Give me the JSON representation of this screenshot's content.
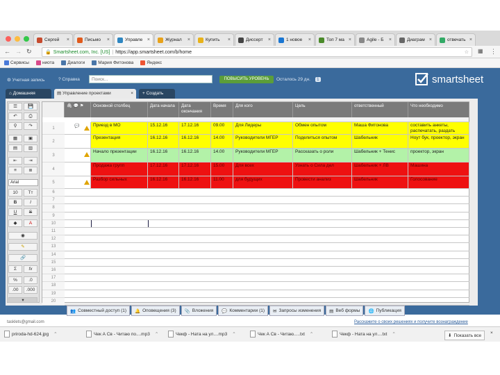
{
  "browser": {
    "tabs": [
      {
        "label": "Сергей",
        "color": "#c64a2e"
      },
      {
        "label": "Письмо",
        "color": "#e05a1c"
      },
      {
        "label": "Управле",
        "color": "#2e86c1"
      },
      {
        "label": "Журнал",
        "color": "#e8a21a"
      },
      {
        "label": "Купить",
        "color": "#e8b21a"
      },
      {
        "label": "Диссерт",
        "color": "#444"
      },
      {
        "label": "1 новое",
        "color": "#1a76d2"
      },
      {
        "label": "Топ 7 ма",
        "color": "#4a8a2a"
      },
      {
        "label": "Agile - Б",
        "color": "#888"
      },
      {
        "label": "Диаграм",
        "color": "#666"
      },
      {
        "label": "отвечать",
        "color": "#3a6"
      }
    ],
    "close": "×",
    "secure_label": "Smartsheet.com, Inc. [US]",
    "url": "https://app.smartsheet.com/b/home",
    "bookmarks": [
      "Сервисы",
      "ниота",
      "Диалоги",
      "Мария Фитонова",
      "Яндекс"
    ]
  },
  "app": {
    "account": "Учетная запись",
    "help": "Справка",
    "search_placeholder": "Поиск...",
    "upgrade": "ПОВЫСИТЬ УРОВЕНЬ",
    "trial": "Осталось 29 дн.",
    "trial_badge": "1",
    "logo": "smartsheet",
    "tabs": {
      "home": "Домашняя",
      "project": "Управление проектами",
      "new": "Создать"
    },
    "font": "Arial"
  },
  "grid": {
    "columns": [
      "Основной столбец",
      "Дата начала",
      "Дата окончания",
      "Время",
      "Для кого",
      "Цель",
      "ответственный",
      "Что необходимо"
    ],
    "rows": [
      {
        "num": "1",
        "color": "#ffff00",
        "cells": [
          "Приезд в МО",
          "15.12.16",
          "17.12.16",
          "09.00",
          "Для Лидеры",
          "Обмен опытом",
          "Маша Фитонова",
          "составить анкеты, распечатать, раздать"
        ],
        "warn": true,
        "comment": true
      },
      {
        "num": "2",
        "color": "#ffff00",
        "cells": [
          "Презентация",
          "16.12.16",
          "16.12.16",
          "14.00",
          "Руководители МГЕР",
          "Поделиться опытом",
          "Шабельник",
          "Ноут бук, проектор, экран"
        ],
        "warn": false,
        "comment": false
      },
      {
        "num": "3",
        "color": "#b3f2a8",
        "cells": [
          "Начало презентации",
          "16.12.16",
          "16.12.16",
          "14.00",
          "Руководители МГЕР",
          "Рассказать о роли",
          "Шабельник + Тенис",
          "проектор, экран"
        ],
        "warn": true,
        "comment": false
      },
      {
        "num": "4",
        "color": "#ee1111",
        "cells": [
          "Продажа групп",
          "17.12.16",
          "17.12.16",
          "15.00",
          "Для всех",
          "Узнать о Сила дел",
          "Шабельник + ЛВ",
          "Машина"
        ],
        "warn": false,
        "comment": false
      },
      {
        "num": "5",
        "color": "#ee1111",
        "cells": [
          "Разбор сильных",
          "16.12.16",
          "16.12.16",
          "11.00",
          "для будущих",
          "Провести анализ",
          "Шабельник",
          "Голосование"
        ],
        "warn": true,
        "comment": false
      }
    ],
    "empty_rows": [
      "6",
      "7",
      "8",
      "9",
      "10",
      "11",
      "12",
      "13",
      "14",
      "15",
      "16",
      "17",
      "18",
      "19",
      "20"
    ]
  },
  "bottom": [
    "Совместный доступ (1)",
    "Оповещения (3)",
    "Вложения",
    "Комментарии (1)",
    "Запросы изменения",
    "Веб формы",
    "Публикация"
  ],
  "status_left": "tasklets@gmail.com",
  "status_right": "Расскажите о своих решениях и получите вознаграждение",
  "downloads": [
    "priroda-hd-624.jpg",
    "Чек А Св - Читаю по....mp3",
    "Чекф - Ната на ул....mp3",
    "Чек А Св - Читаю.....txt",
    "Чекф - Ната на ул....txt"
  ],
  "show_all": "Показать все"
}
